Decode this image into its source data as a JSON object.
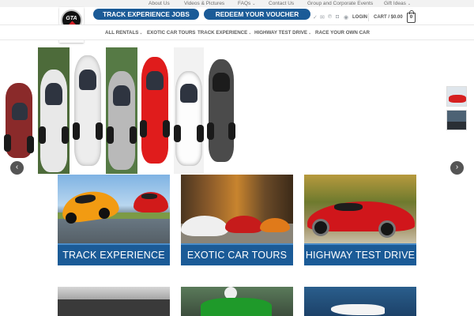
{
  "top_nav": [
    {
      "label": "About Us",
      "has_menu": false
    },
    {
      "label": "Videos & Pictures",
      "has_menu": false
    },
    {
      "label": "FAQs",
      "has_menu": true
    },
    {
      "label": "Contact Us",
      "has_menu": false
    },
    {
      "label": "Group and Corporate Events",
      "has_menu": false
    },
    {
      "label": "Gift Ideas",
      "has_menu": true
    }
  ],
  "logo": {
    "text": "GTA"
  },
  "buttons": {
    "track_jobs": "TRACK EXPERIENCE JOBS",
    "redeem": "REDEEM YOUR VOUCHER"
  },
  "header": {
    "login": "LOGIN",
    "cart": "CART / $0.00",
    "cart_count": "0"
  },
  "social_icons": [
    "twitter-icon",
    "email-icon",
    "pinterest-icon",
    "instagram-icon",
    "rss-icon"
  ],
  "main_nav": [
    {
      "label": "ALL RENTALS",
      "has_menu": true
    },
    {
      "label": "EXOTIC CAR TOURS",
      "has_menu": false
    },
    {
      "label": "TRACK EXPERIENCE",
      "has_menu": true
    },
    {
      "label": "HIGHWAY TEST DRIVE",
      "has_menu": true
    },
    {
      "label": "RACE YOUR OWN CAR",
      "has_menu": false
    }
  ],
  "tiles": [
    {
      "label": "TRACK EXPERIENCE"
    },
    {
      "label": "EXOTIC CAR TOURS"
    },
    {
      "label": "HIGHWAY TEST DRIVE"
    }
  ],
  "colors": {
    "brand_blue": "#1b5b97",
    "accent_red": "#d61f26"
  }
}
